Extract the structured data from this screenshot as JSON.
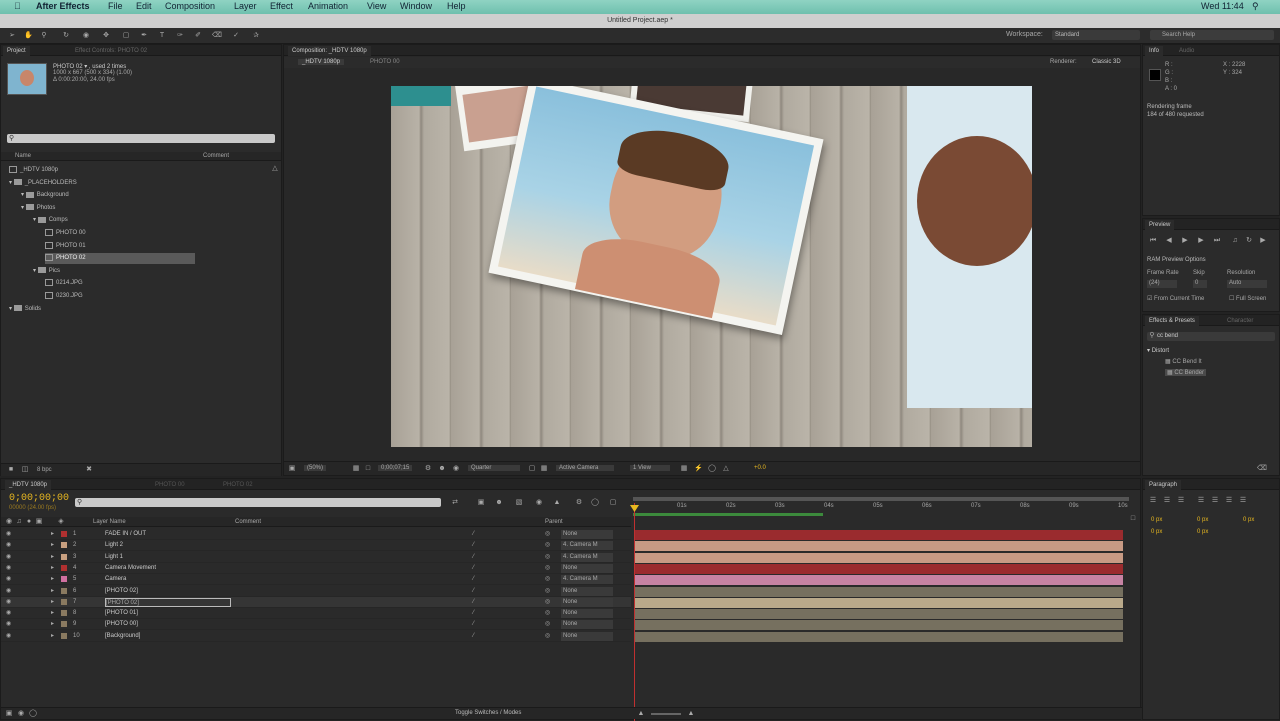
{
  "menubar": {
    "app": "After Effects",
    "items": [
      "File",
      "Edit",
      "Composition",
      "Layer",
      "Effect",
      "Animation",
      "View",
      "Window",
      "Help"
    ],
    "right_status": "Wed 11:44"
  },
  "window": {
    "title": "Untitled Project.aep *"
  },
  "workspace": {
    "label": "Workspace:",
    "value": "Standard",
    "search_placeholder": "Search Help"
  },
  "project": {
    "tab_label": "Project",
    "effect_controls_tab": "Effect Controls: PHOTO 02",
    "selected_name": "PHOTO 02 ▾ , used 2 times",
    "selected_info1": "1000 x 667  (500 x 334) (1.00)",
    "selected_info2": "Δ 0:00:20:00, 24.00 fps",
    "col_name": "Name",
    "col_comment": "Comment",
    "bpc": "8 bpc",
    "tree": [
      {
        "label": "_HDTV 1080p",
        "indent": 0,
        "kind": "comp"
      },
      {
        "label": "_PLACEHOLDERS",
        "indent": 0,
        "kind": "folder"
      },
      {
        "label": "Background",
        "indent": 1,
        "kind": "folder"
      },
      {
        "label": "Photos",
        "indent": 1,
        "kind": "folder"
      },
      {
        "label": "Comps",
        "indent": 2,
        "kind": "folder"
      },
      {
        "label": "PHOTO 00",
        "indent": 3,
        "kind": "comp"
      },
      {
        "label": "PHOTO 01",
        "indent": 3,
        "kind": "comp"
      },
      {
        "label": "PHOTO 02",
        "indent": 3,
        "kind": "comp",
        "selected": true
      },
      {
        "label": "Pics",
        "indent": 2,
        "kind": "folder"
      },
      {
        "label": "0214.JPG",
        "indent": 3,
        "kind": "file"
      },
      {
        "label": "0230.JPG",
        "indent": 3,
        "kind": "file"
      },
      {
        "label": "Solids",
        "indent": 0,
        "kind": "folder"
      }
    ]
  },
  "composition": {
    "tab_label": "Composition: _HDTV 1080p",
    "sub_tabs": [
      "_HDTV 1080p",
      "PHOTO 00"
    ],
    "renderer_label": "Renderer:",
    "renderer_value": "Classic 3D",
    "zoom": "(50%)",
    "timecode": "0;00;07;15",
    "resolution": "Quarter",
    "camera": "Active Camera",
    "views": "1 View",
    "offset": "+0.0"
  },
  "info": {
    "tab_label": "Info",
    "audio_tab": "Audio",
    "r": "R :",
    "g": "G :",
    "b": "B :",
    "a": "A : 0",
    "x": "X : 2228",
    "y": "Y : 324",
    "status1": "Rendering frame",
    "status2": "184 of 480 requested"
  },
  "preview": {
    "tab_label": "Preview",
    "options": "RAM Preview Options",
    "frame_rate_label": "Frame Rate",
    "skip_label": "Skip",
    "resolution_label": "Resolution",
    "frame_rate": "(24)",
    "skip": "0",
    "resolution": "Auto",
    "from_current": "From Current Time",
    "full_screen": "Full Screen"
  },
  "effects": {
    "tab_label": "Effects & Presets",
    "character_tab": "Character",
    "search_value": "cc bend",
    "category": "Distort",
    "items": [
      "CC Bend It",
      "CC Bender"
    ]
  },
  "paragraph": {
    "tab_label": "Paragraph",
    "fields": [
      "0 px",
      "0 px",
      "0 px",
      "0 px",
      "0 px"
    ]
  },
  "timeline": {
    "tabs": [
      "_HDTV 1080p",
      "PHOTO 00",
      "PHOTO 02"
    ],
    "timecode": "0;00;00;00",
    "fps": "00000 (24.00 fps)",
    "col_layer": "Layer Name",
    "col_comment": "Comment",
    "col_parent": "Parent",
    "footer": "Toggle Switches / Modes",
    "ruler": [
      "01s",
      "02s",
      "03s",
      "04s",
      "05s",
      "06s",
      "07s",
      "08s",
      "09s",
      "10s"
    ],
    "layers": [
      {
        "num": "1",
        "name": "FADE IN / OUT",
        "color": "#b03030",
        "parent": "None",
        "bar": "#9a2b2e"
      },
      {
        "num": "2",
        "name": "Light 2",
        "color": "#c8a080",
        "parent": "4. Camera M",
        "bar": "#c79a84"
      },
      {
        "num": "3",
        "name": "Light 1",
        "color": "#c8a080",
        "parent": "4. Camera M",
        "bar": "#c79a84"
      },
      {
        "num": "4",
        "name": "Camera Movement",
        "color": "#b03030",
        "parent": "None",
        "bar": "#9a2b2e"
      },
      {
        "num": "5",
        "name": "Camera",
        "color": "#d070a0",
        "parent": "4. Camera M",
        "bar": "#c783a3"
      },
      {
        "num": "6",
        "name": "[PHOTO 02]",
        "color": "#8a7a60",
        "parent": "None",
        "bar": "#76705f"
      },
      {
        "num": "7",
        "name": "[PHOTO 02]",
        "color": "#8a7a60",
        "parent": "None",
        "bar": "#b9a98a"
      },
      {
        "num": "8",
        "name": "[PHOTO 01]",
        "color": "#8a7a60",
        "parent": "None",
        "bar": "#76705f"
      },
      {
        "num": "9",
        "name": "[PHOTO 00]",
        "color": "#8a7a60",
        "parent": "None",
        "bar": "#76705f"
      },
      {
        "num": "10",
        "name": "[Background]",
        "color": "#8a7a60",
        "parent": "None",
        "bar": "#76705f"
      }
    ]
  }
}
